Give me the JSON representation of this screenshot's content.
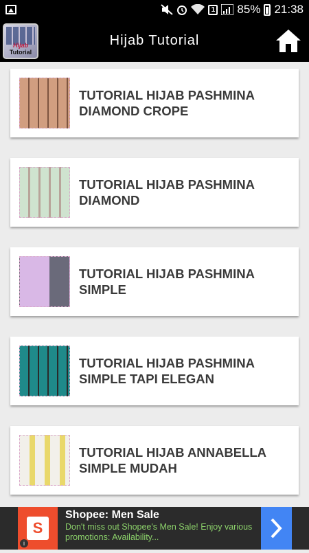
{
  "status_bar": {
    "battery_percent": "85%",
    "time": "21:38",
    "sim_slot": "1"
  },
  "app_bar": {
    "title": "Hijab Tutorial",
    "logo_text_top": "Hijab",
    "logo_text_bottom": "Tutorial"
  },
  "tutorials": [
    {
      "title": "TUTORIAL HIJAB PASHMINA DIAMOND CROPE"
    },
    {
      "title": "TUTORIAL HIJAB PASHMINA DIAMOND"
    },
    {
      "title": "TUTORIAL HIJAB PASHMINA SIMPLE"
    },
    {
      "title": "TUTORIAL HIJAB PASHMINA SIMPLE TAPI ELEGAN"
    },
    {
      "title": "TUTORIAL HIJAB ANNABELLA SIMPLE MUDAH"
    }
  ],
  "ad": {
    "title": "Shopee: Men Sale",
    "description": "Don't miss out Shopee's Men Sale! Enjoy various promotions: Availability...",
    "brand_color": "#ee4d2d",
    "cta_color": "#4285f4"
  },
  "colors": {
    "app_bar": "#000000",
    "background": "#ececec",
    "card": "#ffffff"
  }
}
